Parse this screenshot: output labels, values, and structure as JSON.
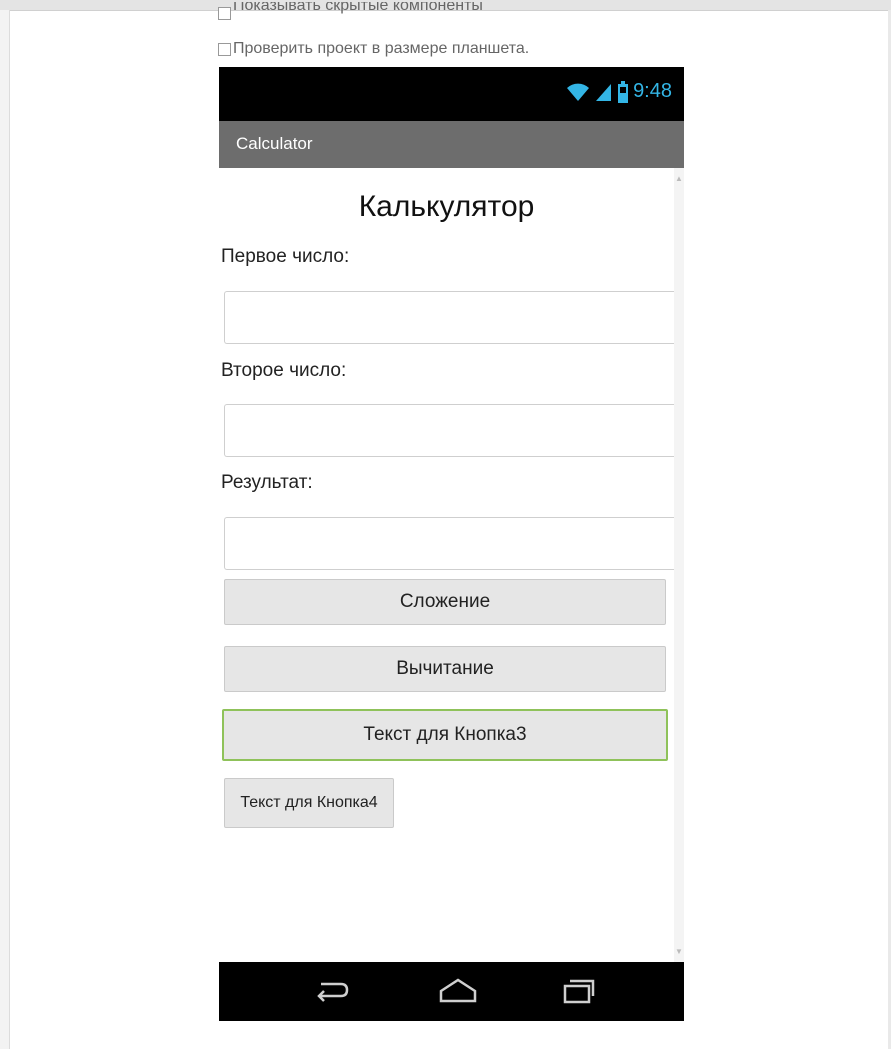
{
  "designer": {
    "show_hidden_label": "Показывать скрытые компоненты",
    "tablet_preview_label": "Проверить проект в размере планшета."
  },
  "phone": {
    "status": {
      "time": "9:48",
      "icons": [
        "wifi-icon",
        "signal-icon",
        "battery-icon"
      ]
    },
    "app_title": "Calculator",
    "screen": {
      "heading": "Калькулятор",
      "first_label": "Первое число:",
      "first_value": "",
      "second_label": "Второе число:",
      "second_value": "",
      "result_label": "Результат:",
      "result_value": "",
      "buttons": {
        "add": "Сложение",
        "subtract": "Вычитание",
        "button3": "Текст для Кнопка3",
        "button4": "Текст для Кнопка4"
      }
    },
    "nav": [
      "back-icon",
      "home-icon",
      "recent-apps-icon"
    ]
  },
  "colors": {
    "status_icons": "#33b5e5",
    "title_bar": "#6d6d6d",
    "selected_outline": "#8fc25a"
  }
}
